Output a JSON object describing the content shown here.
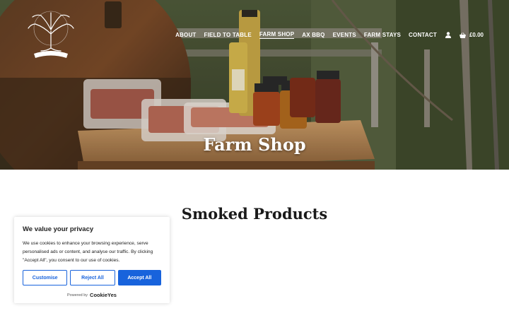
{
  "nav": {
    "items": [
      {
        "label": "ABOUT"
      },
      {
        "label": "FIELD TO TABLE"
      },
      {
        "label": "FARM SHOP"
      },
      {
        "label": "AX BBQ"
      },
      {
        "label": "EVENTS"
      },
      {
        "label": "FARM STAYS"
      },
      {
        "label": "CONTACT"
      }
    ],
    "account_icon": "user-icon",
    "cart_icon": "basket-icon",
    "cart_total": "£0.00"
  },
  "hero": {
    "title": "Farm Shop"
  },
  "section": {
    "title": "Smoked Products"
  },
  "cookie": {
    "heading": "We value your privacy",
    "body": "We use cookies to enhance your browsing experience, serve personalised ads or content, and analyse our traffic. By clicking \"Accept All\", you consent to our use of cookies.",
    "customise_label": "Customise",
    "reject_label": "Reject All",
    "accept_label": "Accept All",
    "powered_by": "Powered by",
    "brand": "CookieYes"
  },
  "colors": {
    "cookie_accent": "#1863dc",
    "heading": "#1a1a1a"
  }
}
